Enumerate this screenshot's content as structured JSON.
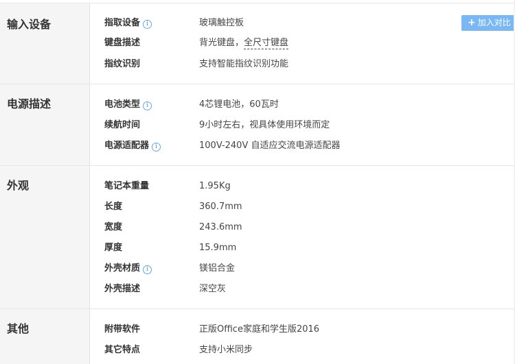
{
  "compare_button": {
    "label": "加入对比"
  },
  "sections": [
    {
      "title": "输入设备",
      "rows": [
        {
          "label": "指取设备",
          "value": "玻璃触控板"
        },
        {
          "label": "键盘描述",
          "value_a": "背光键盘，",
          "value_b": "全尺寸键盘"
        },
        {
          "label": "指纹识别",
          "value": "支持智能指纹识别功能"
        }
      ]
    },
    {
      "title": "电源描述",
      "rows": [
        {
          "label": "电池类型",
          "value": "4芯锂电池，60瓦时"
        },
        {
          "label": "续航时间",
          "value": "9小时左右，视具体使用环境而定"
        },
        {
          "label": "电源适配器",
          "value": "100V-240V 自适应交流电源适配器"
        }
      ]
    },
    {
      "title": "外观",
      "rows": [
        {
          "label": "笔记本重量",
          "value": "1.95Kg"
        },
        {
          "label": "长度",
          "value": "360.7mm"
        },
        {
          "label": "宽度",
          "value": "243.6mm"
        },
        {
          "label": "厚度",
          "value": "15.9mm"
        },
        {
          "label": "外壳材质",
          "value": "镁铝合金"
        },
        {
          "label": "外壳描述",
          "value": "深空灰"
        }
      ]
    },
    {
      "title": "其他",
      "rows": [
        {
          "label": "附带软件",
          "value": "正版Office家庭和学生版2016"
        },
        {
          "label": "其它特点",
          "value": "支持小米同步"
        }
      ]
    }
  ]
}
